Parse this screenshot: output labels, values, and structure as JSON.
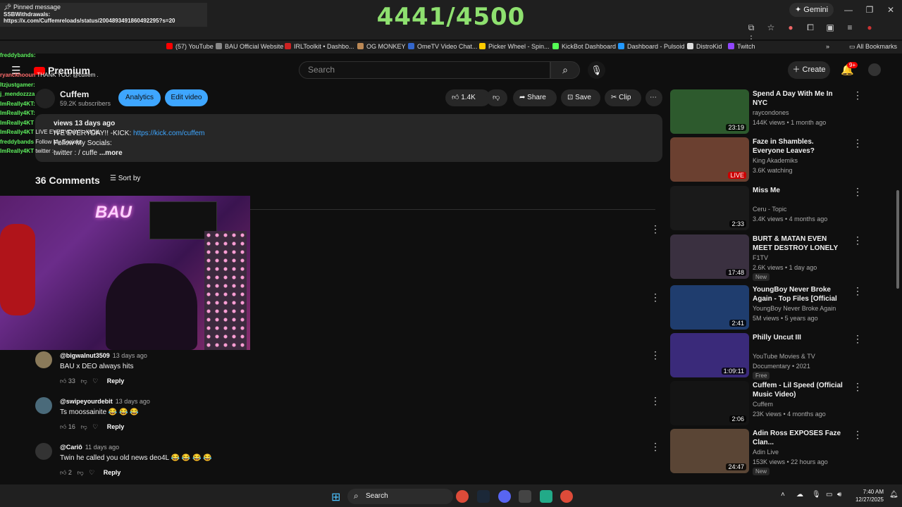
{
  "overlay": {
    "counter": "4441/4500"
  },
  "browser": {
    "gemini": "Gemini",
    "pinned_title": "Pinned message",
    "pinned_author": "SSBWithdrawals:",
    "pinned_link": "https://x.com/Cuffemreloads/status/2004893491860492295?s=20",
    "bookmarks": [
      "(57) YouTube",
      "BAU Official Website",
      "IRLToolkit • Dashbo...",
      "OG MONKEY",
      "OmeTV Video Chat...",
      "Picker Wheel - Spin...",
      "KickBot Dashboard",
      "Dashboard - Pulsoid",
      "DistroKid",
      "Twitch"
    ],
    "all_bookmarks": "All Bookmarks"
  },
  "chat": [
    {
      "user": "freddybands:",
      "text": ""
    },
    {
      "user": "ryanckhooun",
      "text": "THANK YOU! @cuffem ."
    },
    {
      "user": "Itzjustgamer:",
      "text": ""
    },
    {
      "user": "j_mendozzza",
      "text": ""
    },
    {
      "user": "ImReally4KT:",
      "text": ""
    },
    {
      "user": "ImReally4KT:",
      "text": ""
    },
    {
      "user": "ImReally4KT",
      "text": ""
    },
    {
      "user": "ImReally4KT",
      "text": "LIVE EVERYDAY!! -KICK:"
    },
    {
      "user": "freddybands",
      "text": "Follow My Socials:"
    },
    {
      "user": "ImReally4KT",
      "text": "twitter :"
    }
  ],
  "yt": {
    "logo": "Premium",
    "search_placeholder": "Search",
    "create": "Create",
    "notif_count": "9+",
    "channel": "Cuffem",
    "subs": "59.2K subscribers",
    "analytics": "Analytics",
    "edit_video": "Edit video",
    "likes": "1.4K",
    "share": "Share",
    "save": "Save",
    "clip": "Clip",
    "desc_meta": "views  13 days ago",
    "desc_line1": "IVE EVERYDAY!! -KICK: ",
    "desc_link": "https://kick.com/cuffem",
    "desc_line2": "Follow My Socials:",
    "desc_line3": "twitter :  / cuffe",
    "desc_more": "...more",
    "comments_count": "36 Comments",
    "sort_by": "Sort by"
  },
  "comments": [
    {
      "author": "@bigwalnut3509",
      "date": "13 days ago",
      "text": "BAU x DEO always hits",
      "likes": "33",
      "reply": "Reply"
    },
    {
      "author": "@swipeyourdebit",
      "date": "13 days ago",
      "text": "Ts moossainite 😂 😂 😂",
      "likes": "16",
      "reply": "Reply"
    },
    {
      "author": "@Cariô",
      "date": "11 days ago",
      "text": "Twin he called you old news deo4L 😂 😂 😂 😂",
      "likes": "2",
      "reply": "Reply"
    }
  ],
  "sidebar": [
    {
      "title": "Spend A Day With Me In NYC",
      "channel": "raycondones",
      "meta": "144K views • 1 month ago",
      "duration": "23:19",
      "color": "#2d5a2d",
      "badge": ""
    },
    {
      "title": "Faze in Shambles. Everyone Leaves? Blueface vs TI son. ...",
      "channel": "King Akademiks",
      "meta": "3.6K watching",
      "duration": "LIVE",
      "color": "#6b4030",
      "badge": ""
    },
    {
      "title": "Miss Me",
      "channel": "Ceru - Topic",
      "meta": "3.4K views • 4 months ago",
      "duration": "2:33",
      "color": "#1a1a1a",
      "badge": ""
    },
    {
      "title": "BURT & MATAN EVEN MEET DESTROY LONELY",
      "channel": "F1TV",
      "meta": "2.6K views • 1 day ago",
      "duration": "17:48",
      "color": "#3a3040",
      "badge": "New"
    },
    {
      "title": "YoungBoy Never Broke Again - Top Files [Official Audio]",
      "channel": "YoungBoy Never Broke Again",
      "meta": "5M views • 5 years ago",
      "duration": "2:41",
      "color": "#1f3d6e",
      "badge": ""
    },
    {
      "title": "Philly Uncut III",
      "channel": "YouTube Movies & TV",
      "meta": "Documentary • 2021",
      "duration": "1:09:11",
      "color": "#3a2a7a",
      "badge": "Free"
    },
    {
      "title": "Cuffem - Lil Speed (Official Music Video)",
      "channel": "Cuffem",
      "meta": "23K views • 4 months ago",
      "duration": "2:06",
      "color": "#141414",
      "badge": ""
    },
    {
      "title": "Adin Ross EXPOSES Faze Clan...",
      "channel": "Adin Live",
      "meta": "153K views • 22 hours ago",
      "duration": "24:47",
      "color": "#5a4535",
      "badge": "New"
    }
  ],
  "taskbar": {
    "search": "Search",
    "time": "7:40 AM",
    "date": "12/27/2025"
  }
}
